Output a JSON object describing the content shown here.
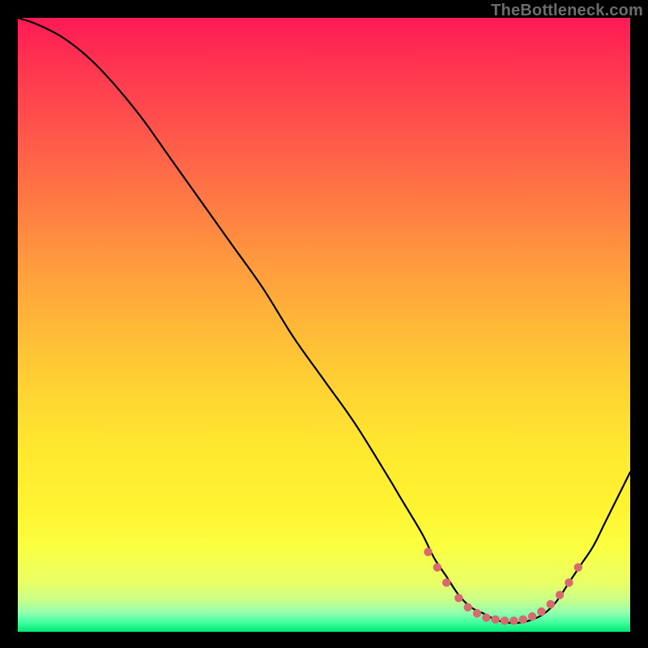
{
  "watermark": "TheBottleneck.com",
  "colors": {
    "frame": "#000000",
    "curve": "#000000",
    "dots": "#d86a6e",
    "gradient_top": "#ff1a55",
    "gradient_bottom": "#00e874",
    "watermark_text": "#6c6c6c"
  },
  "chart_data": {
    "type": "line",
    "title": "",
    "xlabel": "",
    "ylabel": "",
    "xlim": [
      0,
      100
    ],
    "ylim": [
      0,
      100
    ],
    "grid": false,
    "legend": false,
    "series": [
      {
        "name": "curve",
        "x": [
          0,
          3,
          7,
          11,
          15,
          20,
          25,
          30,
          35,
          40,
          45,
          50,
          55,
          60,
          63,
          66,
          68,
          70,
          72,
          74,
          76,
          78,
          80,
          82,
          84,
          86,
          88,
          90,
          92,
          94,
          96,
          98,
          100
        ],
        "y": [
          100,
          99,
          97,
          94,
          90,
          84,
          77,
          70,
          63,
          56,
          48,
          41,
          34,
          26,
          21,
          16,
          12,
          9,
          6,
          4,
          3,
          2,
          1.5,
          1.5,
          2,
          3,
          5,
          8,
          11,
          14,
          18,
          22,
          26
        ]
      }
    ],
    "highlight_dots": {
      "name": "flat-region-dots",
      "x": [
        67,
        68.5,
        70,
        72,
        73.5,
        75,
        76.5,
        78,
        79.5,
        81,
        82.5,
        84,
        85.5,
        87,
        88.5,
        90,
        91.5
      ],
      "y": [
        13,
        10.5,
        8,
        5.5,
        4,
        3,
        2.3,
        2,
        1.8,
        1.8,
        2,
        2.5,
        3.3,
        4.5,
        6,
        8,
        10.5
      ]
    }
  }
}
